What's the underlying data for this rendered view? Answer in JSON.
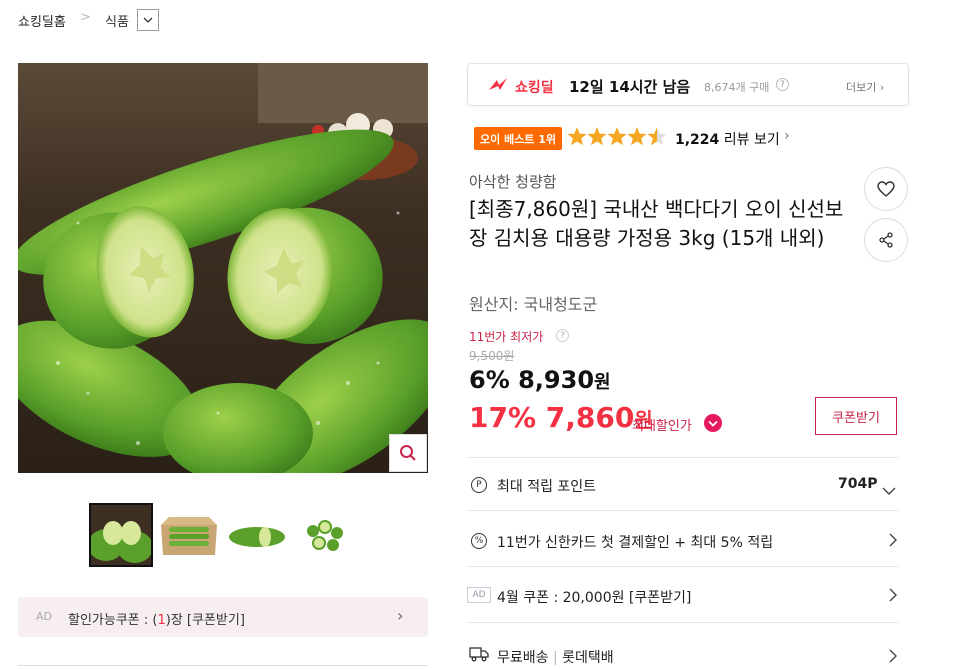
{
  "breadcrumb": {
    "home": "쇼킹딜홈",
    "separator": ">",
    "category": "식품",
    "dropdown_icon": "chevron-down-icon"
  },
  "gallery": {
    "zoom_icon": "search-icon",
    "thumbnail_count": 4
  },
  "ad_coupon": {
    "label": "AD",
    "text_before": "할인가능쿠폰 : (",
    "count": "1",
    "text_after": ")장 [쿠폰받기]",
    "arrow": "›"
  },
  "deal": {
    "brand": "쇼킹딜",
    "time_left": "12일 14시간 남음",
    "purchases": "8,674개 구매",
    "help": "?",
    "more": "더보기 ›"
  },
  "rating": {
    "badge": "오이 베스트 1위",
    "stars": 4.5,
    "review_count": "1,224",
    "review_label": "리뷰 보기",
    "arrow": "›"
  },
  "product": {
    "subtitle": "아삭한 청량함",
    "title": "[최종7,860원] 국내산 백다다기 오이 신선보장 김치용 대용량 가정용 3kg (15개 내외)",
    "origin": "원산지:  국내청도군"
  },
  "price": {
    "lowest_label": "11번가 최저가",
    "original": "9,500원",
    "discount1": "6%",
    "price1": "8,930",
    "won": "원",
    "discount2": "17%",
    "price2": "7,860",
    "max_label": "최대할인가",
    "coupon_button": "쿠폰받기"
  },
  "info_rows": {
    "points_label": "최대 적립 포인트",
    "points_value": "704P",
    "points_icon": "P",
    "card_label": "11번가 신한카드 첫 결제할인 + 최대 5% 적립",
    "card_icon": "%",
    "coupon_tag": "AD",
    "coupon_label": "4월 쿠폰 : 20,000원 [쿠폰받기]",
    "shipping_label": "무료배송",
    "shipping_sep": "|",
    "shipping_company": "롯데택배"
  },
  "colors": {
    "accent": "#f43142",
    "deep_pink": "#c8234a",
    "badge_orange": "#ff6a00",
    "star": "#f5a623"
  }
}
